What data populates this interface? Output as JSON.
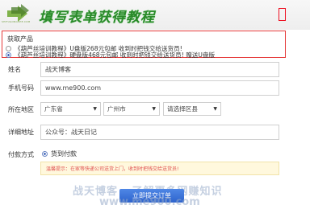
{
  "header": {
    "logo_text": "SHIFUGONGSHE.COM",
    "title": "填写表单获得教程"
  },
  "product": {
    "label": "获取产品",
    "options": [
      "《葫芦丝培训教程》U盘版268元包邮 收到时把钱交给送货员!",
      "《葫芦丝培训教程》硬盘版468元包邮 收到时把钱交给送货员! 赠送U盘版"
    ],
    "selected_index": 1
  },
  "form": {
    "name_label": "姓名",
    "name_placeholder": "战天博客",
    "phone_label": "手机号码",
    "phone_value": "www.me900.com",
    "region_label": "所在地区",
    "province": "广东省",
    "city": "广州市",
    "district": "请选择区县",
    "address_label": "详细地址",
    "address_placeholder": "公众号：战天日记",
    "payment_label": "付款方式",
    "payment_option": "货到付款",
    "notice": "温馨提示：在家等快递公司送货上门，收到时把钱交给送货员!",
    "submit_label": "立即提交订单"
  },
  "watermark": {
    "line1": "战天博客 - 了解更多网赚知识",
    "line2": "www.me900.com"
  },
  "colors": {
    "title_green": "#2a8a2a",
    "product_border": "#e53a3a",
    "submit_blue": "#2d63cc",
    "notice_bg": "#fff8dd",
    "notice_text": "#e05050"
  }
}
